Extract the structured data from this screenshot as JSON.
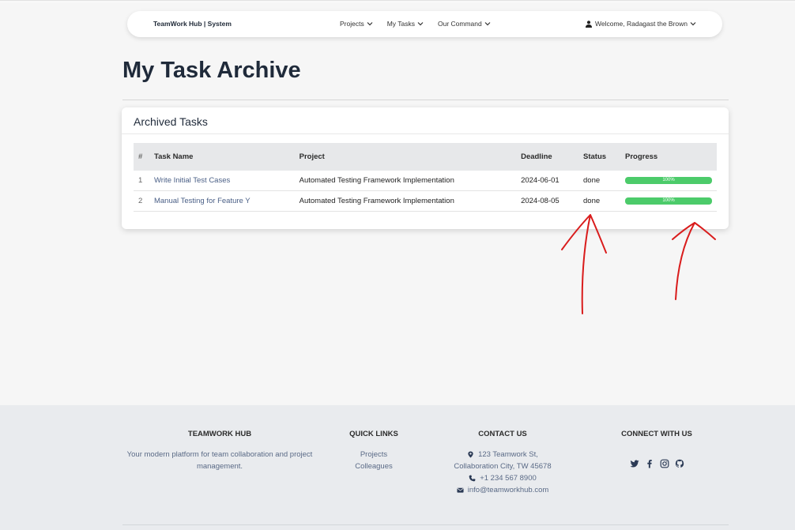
{
  "navbar": {
    "brand": "TeamWork Hub | System",
    "menu": [
      {
        "label": "Projects",
        "icon": "chevron-down-icon"
      },
      {
        "label": "My Tasks",
        "icon": "chevron-down-icon"
      },
      {
        "label": "Our Command",
        "icon": "chevron-down-icon"
      }
    ],
    "user": {
      "label": "Welcome, Radagast the Brown",
      "icon": "user-icon"
    }
  },
  "page": {
    "title": "My Task Archive"
  },
  "card": {
    "title": "Archived Tasks",
    "columns": [
      "#",
      "Task Name",
      "Project",
      "Deadline",
      "Status",
      "Progress"
    ],
    "rows": [
      {
        "num": "1",
        "task": "Write Initial Test Cases",
        "project": "Automated Testing Framework Implementation",
        "deadline": "2024-06-01",
        "status": "done",
        "progress_label": "100%",
        "progress": 1.0
      },
      {
        "num": "2",
        "task": "Manual Testing for Feature Y",
        "project": "Automated Testing Framework Implementation",
        "deadline": "2024-08-05",
        "status": "done",
        "progress_label": "100%",
        "progress": 1.0
      }
    ]
  },
  "footer": {
    "about": {
      "heading": "TEAMWORK HUB",
      "text": "Your modern platform for team collaboration and project management."
    },
    "links": {
      "heading": "QUICK LINKS",
      "items": [
        "Projects",
        "Colleagues"
      ]
    },
    "contact": {
      "heading": "CONTACT US",
      "address_line1": "123 Teamwork St,",
      "address_line2": "Collaboration City, TW 45678",
      "phone": "+1 234 567 8900",
      "email": "info@teamworkhub.com"
    },
    "social": {
      "heading": "CONNECT WITH US",
      "icons": [
        "twitter-icon",
        "facebook-icon",
        "instagram-icon",
        "github-icon"
      ]
    }
  },
  "colors": {
    "accent_link": "#4a5f86",
    "progress_fill": "#4ccb6a",
    "annotation": "#d91c1c"
  }
}
